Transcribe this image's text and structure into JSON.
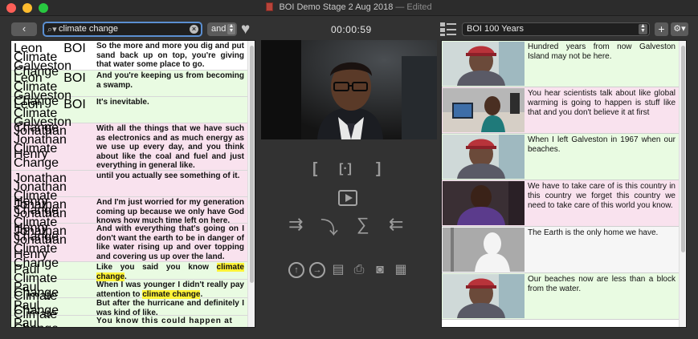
{
  "window": {
    "title": "BOI Demo Stage 2 Aug 2018",
    "status": "— Edited"
  },
  "toolbar": {
    "back_label": "‹",
    "search_value": "climate change",
    "search_icon": "magnifier-icon",
    "operator": "and",
    "timecode": "00:00:59",
    "collection": "BOI 100 Years",
    "add_label": "+",
    "gear_label": "⚙▾"
  },
  "transcript": [
    {
      "tags": [
        "Leon",
        "BOI",
        "Climate Change",
        "Galveston"
      ],
      "text": "So the more and more you dig and put sand back up on top, you're giving that water some place to go.",
      "color": "#ffffff"
    },
    {
      "tags": [
        "Leon",
        "BOI",
        "Climate Change",
        "Galveston"
      ],
      "text": "And you're keeping us from becoming a swamp.",
      "color": "#e9fbe2"
    },
    {
      "tags": [
        "Leon",
        "BOI",
        "Climate Change",
        "Galveston"
      ],
      "text": "It's inevitable.",
      "color": "#e9fbe2"
    },
    {
      "tags": [
        "Jonathan",
        "Jonathan Henry",
        "Climate Change"
      ],
      "text": "With all the things that we have such as electronics and as much energy as we use up every day, and you think about like the coal and fuel and just everything in general like.",
      "color": "#f9e2ee"
    },
    {
      "tags": [
        "Jonathan",
        "Jonathan Henry",
        "Climate Change"
      ],
      "text": "until you actually see something of it.",
      "color": "#f9e2ee"
    },
    {
      "tags": [
        "Jonathan",
        "Jonathan Henry",
        "Climate Change"
      ],
      "text": "And I'm just worried for my generation coming up because we only have God knows how much time left on here.",
      "color": "#f9e2ee"
    },
    {
      "tags": [
        "Jonathan",
        "Jonathan Henry",
        "Climate Change"
      ],
      "text": "And with everything that's going on I don't want the earth to be in danger of like water rising up and over topping and covering us up over the land.",
      "color": "#f9e2ee"
    },
    {
      "tags": [
        "Paul",
        "Climate Change"
      ],
      "text_parts": [
        "Like you said you know ",
        "climate change",
        "."
      ],
      "color": "#e9fbe2"
    },
    {
      "tags": [
        "Paul",
        "Climate Change"
      ],
      "text_parts": [
        "When I was younger I didn't really pay attention to ",
        "climate change",
        "."
      ],
      "color": "#e9fbe2"
    },
    {
      "tags": [
        "Paul",
        "Climate Change"
      ],
      "text": "But after the hurricane and definitely I was kind of like.",
      "color": "#e9fbe2"
    },
    {
      "tags": [
        "Paul"
      ],
      "text": "You know this could happen at",
      "color": "#e9fbe2"
    }
  ],
  "clips": [
    {
      "text": "Hundred years from now Galveston Island may not be here.",
      "color": "#e9fbe2",
      "thumb": "man-red-cap"
    },
    {
      "text": "You hear scientists talk about like global warming is going to happen is stuff like that and you don't believe it at first",
      "color": "#f9e2ee",
      "thumb": "teen-at-desk"
    },
    {
      "text": "When I left Galveston in 1967 when our beaches.",
      "color": "#e9fbe2",
      "thumb": "man-red-cap"
    },
    {
      "text": "We have to take care of is this country in this country we forget this country we need to take care of this world you know.",
      "color": "#f9e2ee",
      "thumb": "man-purple-shirt"
    },
    {
      "text": "The Earth is the only home we have.",
      "color": "#f6f6f6",
      "thumb": "silhouette"
    },
    {
      "text": "Our beaches now are less than a block from the water.",
      "color": "#e9fbe2",
      "thumb": "man-red-cap"
    }
  ],
  "colors": {
    "tag_chip": "#a9c7ec",
    "highlight": "#fff337",
    "green_row": "#e9fbe2",
    "pink_row": "#f9e2ee"
  }
}
